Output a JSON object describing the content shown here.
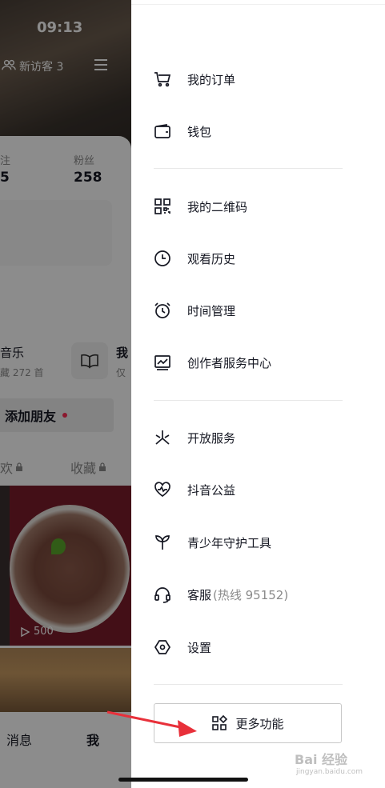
{
  "status_bar": {
    "time": "09:13"
  },
  "profile": {
    "visitors_label": "新访客 3",
    "stats": [
      {
        "label": "注",
        "value": "5"
      },
      {
        "label": "粉丝",
        "value": "258"
      }
    ],
    "music_title": "音乐",
    "music_sub": "藏 272 首",
    "book_title": "我",
    "book_sub": "仅",
    "add_friend_label": "添加朋友",
    "tabs": [
      "欢",
      "收藏"
    ],
    "play_count": "500",
    "bottom_nav": {
      "messages": "消息",
      "me": "我"
    }
  },
  "drawer": {
    "groups": [
      [
        {
          "label": "我的订单",
          "icon": "cart-icon"
        },
        {
          "label": "钱包",
          "icon": "wallet-icon"
        }
      ],
      [
        {
          "label": "我的二维码",
          "icon": "qrcode-icon"
        },
        {
          "label": "观看历史",
          "icon": "clock-icon"
        },
        {
          "label": "时间管理",
          "icon": "alarm-icon"
        },
        {
          "label": "创作者服务中心",
          "icon": "chart-icon"
        }
      ],
      [
        {
          "label": "开放服务",
          "icon": "spark-icon"
        },
        {
          "label": "抖音公益",
          "icon": "heart-icon"
        },
        {
          "label": "青少年守护工具",
          "icon": "sprout-icon"
        },
        {
          "label": "客服",
          "sub": "(热线 95152)",
          "icon": "headset-icon"
        },
        {
          "label": "设置",
          "icon": "settings-icon"
        }
      ]
    ],
    "more_button": "更多功能"
  },
  "watermark": {
    "text": "Bai 经验",
    "sub": "jingyan.baidu.com"
  },
  "colors": {
    "accent_red": "#fe2c55",
    "arrow_red": "#e8303a",
    "text": "#161823",
    "muted": "#8a8a8a"
  }
}
